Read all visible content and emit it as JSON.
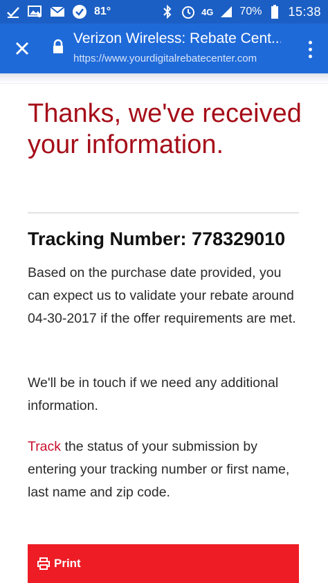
{
  "status_bar": {
    "temperature": "81°",
    "network": "4G",
    "battery": "70%",
    "time": "15:38"
  },
  "browser": {
    "title": "Verizon Wireless: Rebate Cent...",
    "url": "https://www.yourdigitalrebatecenter.com"
  },
  "page": {
    "heading": "Thanks, we've received your information.",
    "tracking_label": "Tracking Number: 778329010",
    "paragraph1": "Based on the purchase date provided, you can expect us to validate your rebate around 04-30-2017 if the offer requirements are met.",
    "paragraph2": "We'll be in touch if we need any additional information.",
    "track_link": "Track",
    "paragraph3_rest": " the status of your submission by entering your tracking number or first name, last name and zip code.",
    "print_label": "Print"
  },
  "colors": {
    "status_bar": "#1c5fc4",
    "toolbar": "#1f6ad9",
    "heading": "#a50d18",
    "link": "#c8102e",
    "print_button": "#ee1c25"
  }
}
